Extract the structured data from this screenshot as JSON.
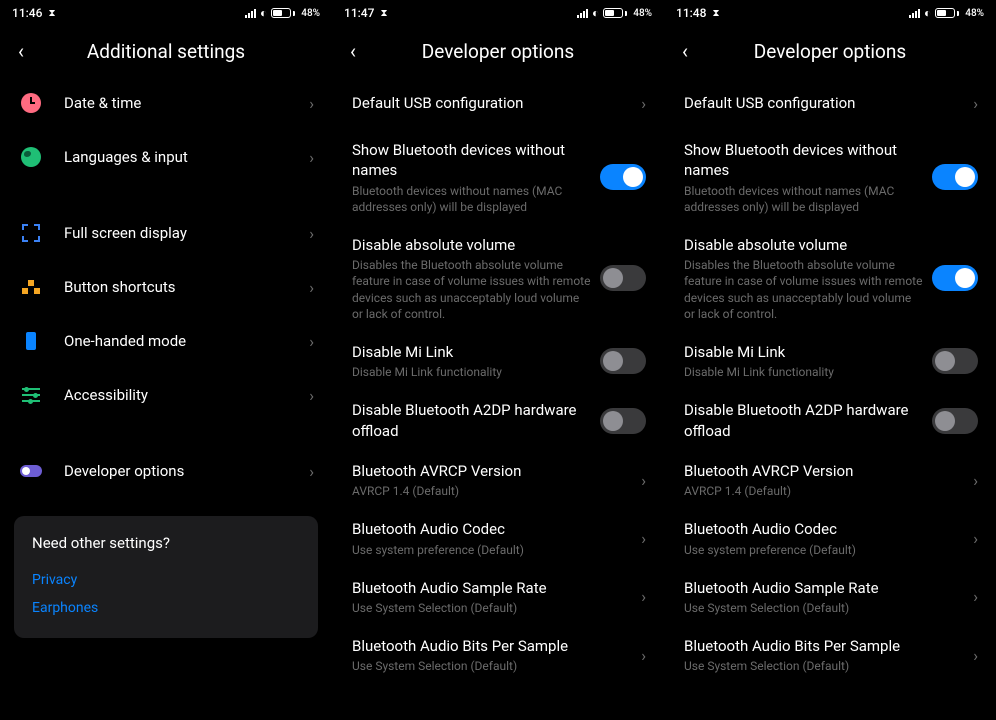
{
  "screens": [
    {
      "status": {
        "time": "11:46",
        "battery": "48"
      },
      "title": "Additional settings",
      "groups": [
        [
          {
            "icon": "clock",
            "title": "Date & time",
            "type": "nav"
          },
          {
            "icon": "globe",
            "title": "Languages & input",
            "type": "nav"
          }
        ],
        [
          {
            "icon": "fullscreen",
            "title": "Full screen display",
            "type": "nav"
          },
          {
            "icon": "shortcuts",
            "title": "Button shortcuts",
            "type": "nav"
          },
          {
            "icon": "phone",
            "title": "One-handed mode",
            "type": "nav"
          },
          {
            "icon": "access",
            "title": "Accessibility",
            "type": "nav"
          }
        ],
        [
          {
            "icon": "dev",
            "title": "Developer options",
            "type": "nav"
          }
        ]
      ],
      "footer": {
        "q": "Need other settings?",
        "links": [
          "Privacy",
          "Earphones"
        ]
      }
    },
    {
      "status": {
        "time": "11:47",
        "battery": "48"
      },
      "title": "Developer options",
      "items": [
        {
          "title": "Default USB configuration",
          "type": "nav"
        },
        {
          "title": "Show Bluetooth devices without names",
          "sub": "Bluetooth devices without names (MAC addresses only) will be displayed",
          "type": "toggle",
          "on": true
        },
        {
          "title": "Disable absolute volume",
          "sub": "Disables the Bluetooth absolute volume feature in case of volume issues with remote devices such as unacceptably loud volume or lack of control.",
          "type": "toggle",
          "on": false
        },
        {
          "title": "Disable Mi Link",
          "sub": "Disable Mi Link functionality",
          "type": "toggle",
          "on": false
        },
        {
          "title": "Disable Bluetooth A2DP hardware offload",
          "type": "toggle",
          "on": false
        },
        {
          "title": "Bluetooth AVRCP Version",
          "sub": "AVRCP 1.4 (Default)",
          "type": "nav"
        },
        {
          "title": "Bluetooth Audio Codec",
          "sub": "Use system preference (Default)",
          "type": "nav"
        },
        {
          "title": "Bluetooth Audio Sample Rate",
          "sub": "Use System Selection (Default)",
          "type": "nav"
        },
        {
          "title": "Bluetooth Audio Bits Per Sample",
          "sub": "Use System Selection (Default)",
          "type": "nav"
        }
      ]
    },
    {
      "status": {
        "time": "11:48",
        "battery": "48"
      },
      "title": "Developer options",
      "items": [
        {
          "title": "Default USB configuration",
          "type": "nav"
        },
        {
          "title": "Show Bluetooth devices without names",
          "sub": "Bluetooth devices without names (MAC addresses only) will be displayed",
          "type": "toggle",
          "on": true
        },
        {
          "title": "Disable absolute volume",
          "sub": "Disables the Bluetooth absolute volume feature in case of volume issues with remote devices such as unacceptably loud volume or lack of control.",
          "type": "toggle",
          "on": true
        },
        {
          "title": "Disable Mi Link",
          "sub": "Disable Mi Link functionality",
          "type": "toggle",
          "on": false
        },
        {
          "title": "Disable Bluetooth A2DP hardware offload",
          "type": "toggle",
          "on": false
        },
        {
          "title": "Bluetooth AVRCP Version",
          "sub": "AVRCP 1.4 (Default)",
          "type": "nav"
        },
        {
          "title": "Bluetooth Audio Codec",
          "sub": "Use system preference (Default)",
          "type": "nav"
        },
        {
          "title": "Bluetooth Audio Sample Rate",
          "sub": "Use System Selection (Default)",
          "type": "nav"
        },
        {
          "title": "Bluetooth Audio Bits Per Sample",
          "sub": "Use System Selection (Default)",
          "type": "nav"
        }
      ]
    }
  ]
}
